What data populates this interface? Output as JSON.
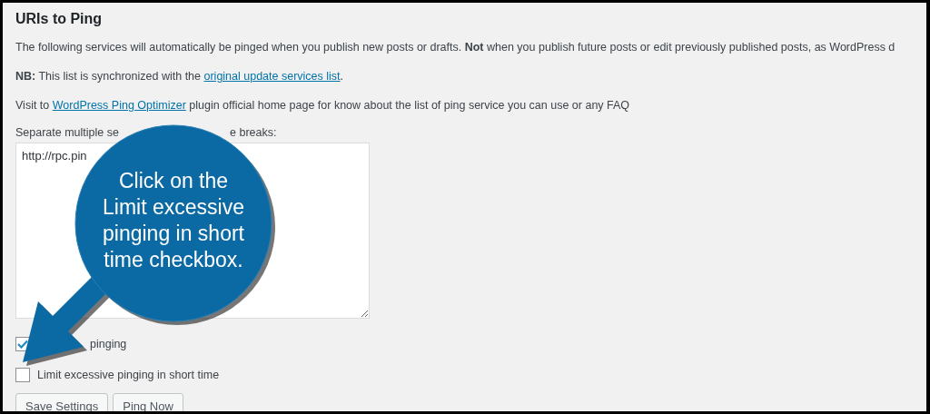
{
  "section": {
    "title": "URIs to Ping",
    "paragraphs": [
      {
        "before": "The following services will automatically be pinged when you publish new posts or drafts. **Not** when you publish future posts or edit previously published posts, as WordPress d"
      },
      {
        "before": "**NB:** This list is synchronized with the ",
        "link": "original update services list",
        "after": "."
      },
      {
        "before": "Visit to ",
        "link": "WordPress Ping Optimizer",
        "after": " plugin official home page for know about the list of ping service you can use or any FAQ"
      }
    ],
    "field_label_parts": [
      "Separate multiple se",
      "e breaks:"
    ],
    "services_field": {
      "value": "http://rpc.pin"
    },
    "checkboxes": [
      {
        "label": "pinging",
        "checked": true
      },
      {
        "label": "Limit excessive pinging in short time",
        "checked": false
      }
    ],
    "buttons": [
      "Save Settings",
      "Ping Now"
    ]
  },
  "callout": {
    "lines": [
      "Click on the",
      "Limit excessive",
      "pinging in short",
      "time checkbox."
    ]
  }
}
